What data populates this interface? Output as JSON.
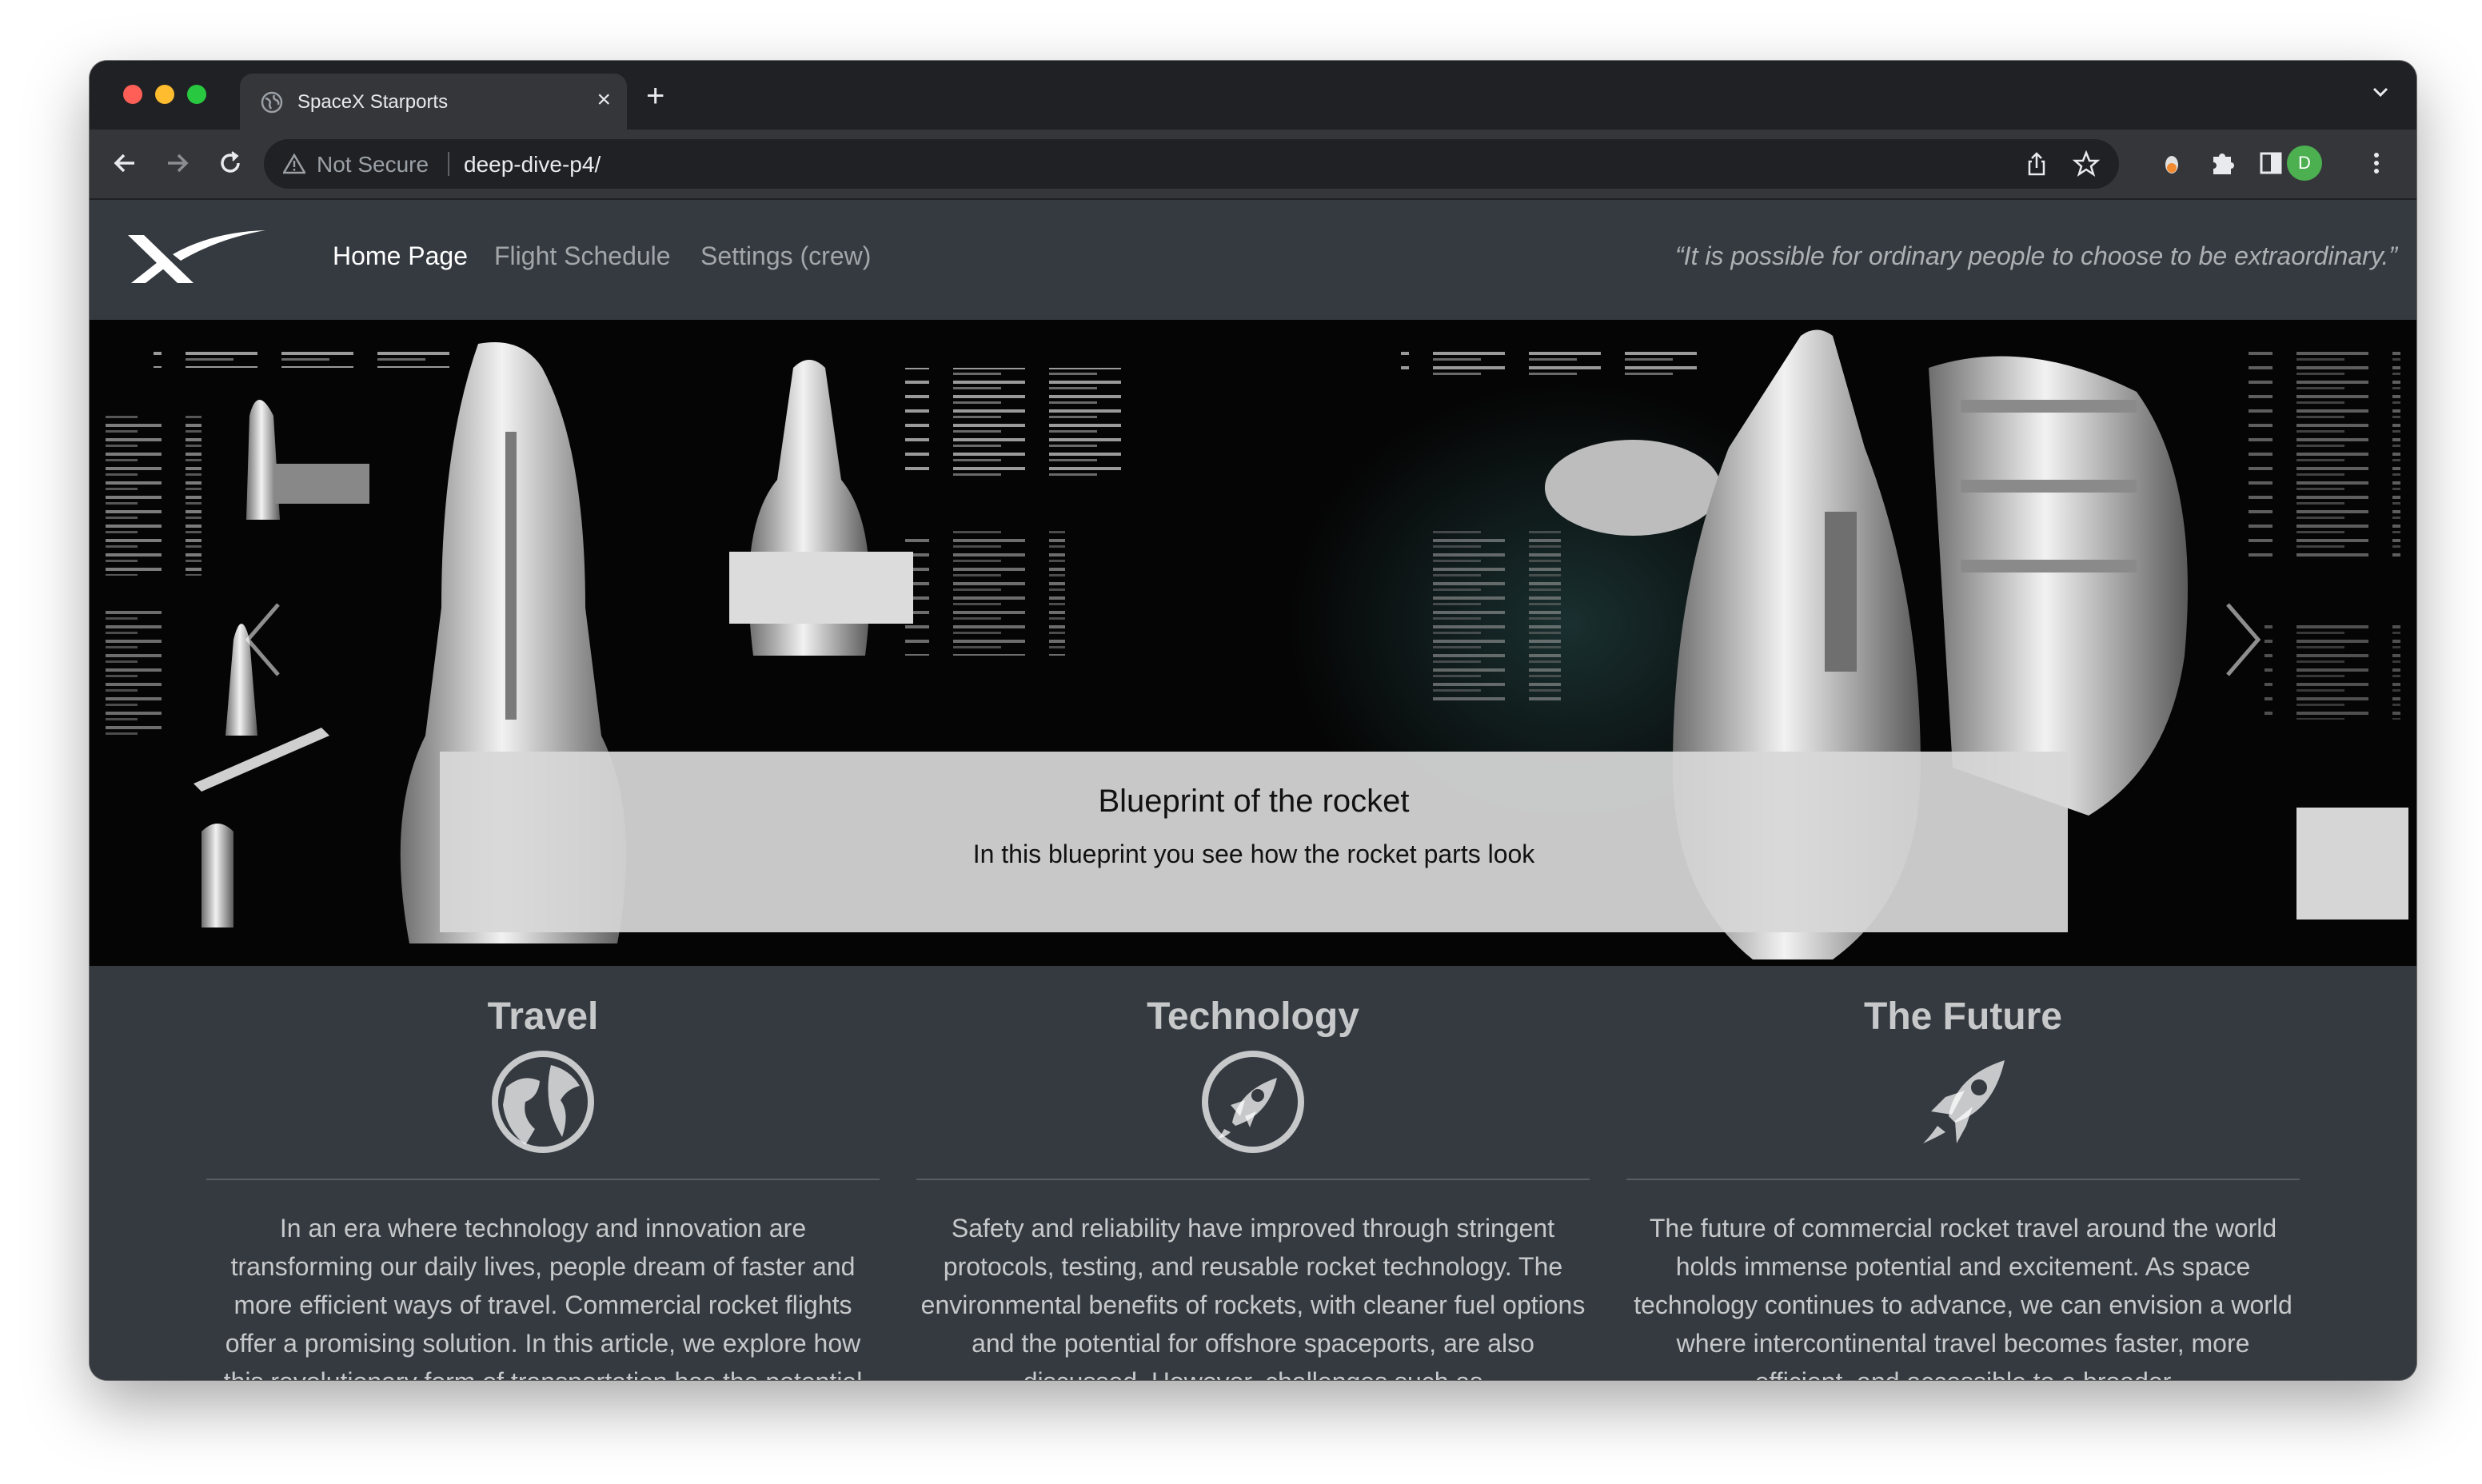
{
  "browser": {
    "tab_title": "SpaceX Starports",
    "new_tab_symbol": "+",
    "close_symbol": "×",
    "security_label": "Not Secure",
    "url": "deep-dive-p4/",
    "profile_initial": "D"
  },
  "site": {
    "nav": {
      "links": [
        {
          "label": "Home Page",
          "active": true
        },
        {
          "label": "Flight Schedule",
          "active": false
        },
        {
          "label": "Settings (crew)",
          "active": false
        }
      ],
      "quote": "“It is possible for ordinary people to choose to be extraordinary.”"
    },
    "carousel": {
      "caption_title": "Blueprint of the rocket",
      "caption_text": "In this blueprint you see how the rocket parts look"
    },
    "columns": [
      {
        "title": "Travel",
        "icon": "globe-icon",
        "text": "In an era where technology and innovation are transforming our daily lives, people dream of faster and more efficient ways of travel. Commercial rocket flights offer a promising solution. In this article, we explore how this revolutionary form of transportation has the potential"
      },
      {
        "title": "Technology",
        "icon": "rocket-circle-icon",
        "text": "Safety and reliability have improved through stringent protocols, testing, and reusable rocket technology. The environmental benefits of rockets, with cleaner fuel options and the potential for offshore spaceports, are also discussed. However, challenges such as"
      },
      {
        "title": "The Future",
        "icon": "rocket-icon",
        "text": "The future of commercial rocket travel around the world holds immense potential and excitement. As space technology continues to advance, we can envision a world where intercontinental travel becomes faster, more efficient, and accessible to a broader"
      }
    ]
  },
  "colors": {
    "page_bg": "#343a40",
    "chrome_dark": "#202124",
    "chrome_mid": "#35363a",
    "caption_bg": "#d7d7d7"
  }
}
